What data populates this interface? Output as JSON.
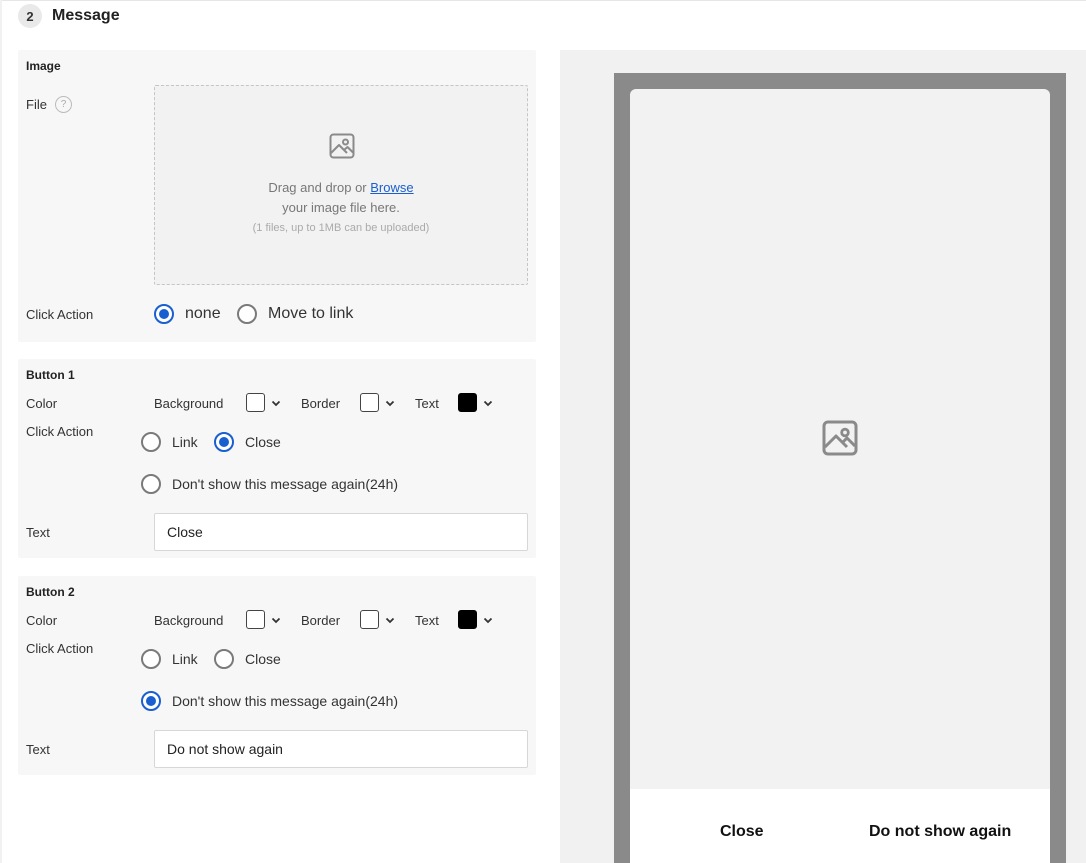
{
  "step": {
    "number": "2",
    "title": "Message"
  },
  "image_section": {
    "title": "Image",
    "file_label": "File",
    "help_icon": "question-circle-icon",
    "dropzone": {
      "icon": "image-icon",
      "text_before": "Drag and drop or ",
      "browse_link": "Browse",
      "line2": "your image file here.",
      "limit_note": "(1 files, up to 1MB can be uploaded)"
    },
    "click_action_label": "Click Action",
    "click_action_options": [
      {
        "label": "none",
        "selected": true
      },
      {
        "label": "Move to link",
        "selected": false
      }
    ]
  },
  "button1": {
    "title": "Button 1",
    "color_label": "Color",
    "background_label": "Background",
    "border_label": "Border",
    "text_color_label": "Text",
    "background_color": "#ffffff",
    "border_color": "#ffffff",
    "text_color": "#000000",
    "click_action_label": "Click Action",
    "options": [
      {
        "label": "Link",
        "selected": false
      },
      {
        "label": "Close",
        "selected": true
      },
      {
        "label": "Don't show this message again(24h)",
        "selected": false
      }
    ],
    "text_label": "Text",
    "text_value": "Close"
  },
  "button2": {
    "title": "Button 2",
    "color_label": "Color",
    "background_label": "Background",
    "border_label": "Border",
    "text_color_label": "Text",
    "background_color": "#ffffff",
    "border_color": "#ffffff",
    "text_color": "#000000",
    "click_action_label": "Click Action",
    "options": [
      {
        "label": "Link",
        "selected": false
      },
      {
        "label": "Close",
        "selected": false
      },
      {
        "label": "Don't show this message again(24h)",
        "selected": true
      }
    ],
    "text_label": "Text",
    "text_value": "Do not show again"
  },
  "preview": {
    "image_placeholder_icon": "image-icon",
    "button1_label": "Close",
    "button2_label": "Do not show again",
    "frame_color": "#8a8a8a",
    "accent_color": "#1a5fd0"
  }
}
